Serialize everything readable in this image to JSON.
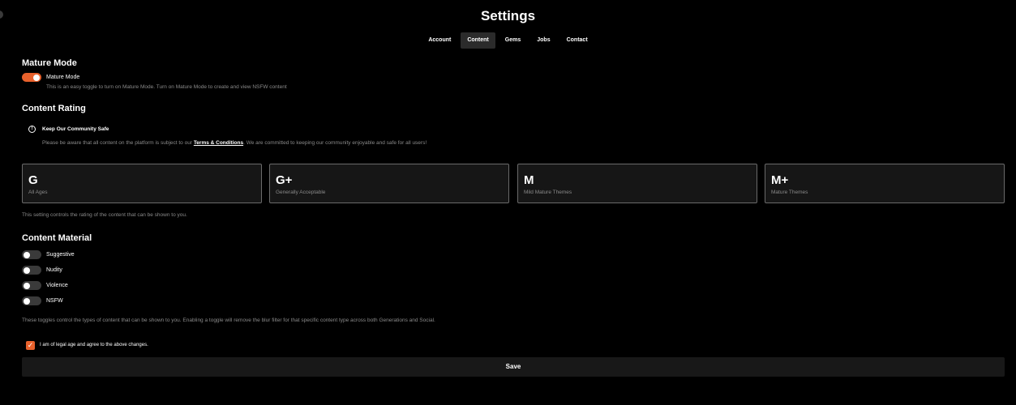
{
  "header": {
    "title": "Settings",
    "tabs": [
      {
        "label": "Account",
        "active": false
      },
      {
        "label": "Content",
        "active": true
      },
      {
        "label": "Gems",
        "active": false
      },
      {
        "label": "Jobs",
        "active": false
      },
      {
        "label": "Contact",
        "active": false
      }
    ]
  },
  "mature_mode": {
    "section_title": "Mature Mode",
    "toggle_label": "Mature Mode",
    "toggle_on": true,
    "description": "This is an easy toggle to turn on Mature Mode. Turn on Mature Mode to create and view NSFW content"
  },
  "content_rating": {
    "section_title": "Content Rating",
    "notice": {
      "title": "Keep Our Community Safe",
      "text_before": "Please be aware that all content on the platform is subject to our ",
      "link": "Terms & Conditions",
      "text_after": ". We are committed to keeping our community enjoyable and safe for all users!"
    },
    "ratings": [
      {
        "letter": "G",
        "label": "All Ages"
      },
      {
        "letter": "G+",
        "label": "Generally Acceptable"
      },
      {
        "letter": "M",
        "label": "Mild Mature Themes"
      },
      {
        "letter": "M+",
        "label": "Mature Themes"
      }
    ],
    "footnote": "This setting controls the rating of the content that can be shown to you."
  },
  "content_material": {
    "section_title": "Content Material",
    "toggles": [
      {
        "label": "Suggestive",
        "on": false
      },
      {
        "label": "Nudity",
        "on": false
      },
      {
        "label": "Violence",
        "on": false
      },
      {
        "label": "NSFW",
        "on": false
      }
    ],
    "footnote": "These toggles control the types of content that can be shown to you. Enabling a toggle will remove the blur filter for that specific content type across both Generations and Social."
  },
  "agreement": {
    "checked": true,
    "check_glyph": "✓",
    "label": "I am of legal age and agree to the above changes."
  },
  "save_label": "Save",
  "colors": {
    "accent": "#e8612c",
    "background": "#000000",
    "card": "#161616"
  }
}
